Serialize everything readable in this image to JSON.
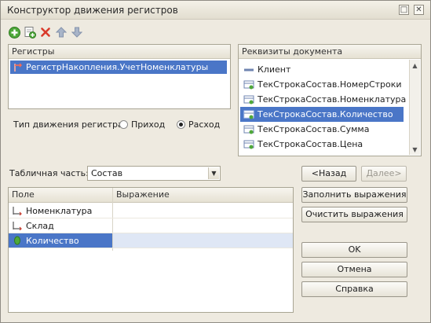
{
  "window": {
    "title": "Конструктор движения регистров",
    "buttons": {
      "restore_glyph": "□",
      "close_glyph": "✕"
    }
  },
  "toolbar": {
    "icons": [
      "add-icon",
      "copy-icon",
      "delete-icon",
      "move-up-icon",
      "move-down-icon"
    ]
  },
  "registers": {
    "header": "Регистры",
    "items": [
      {
        "label": "РегистрНакопления.УчетНоменклатуры"
      }
    ]
  },
  "attributes": {
    "header": "Реквизиты документа",
    "items": [
      {
        "label": "Клиент"
      },
      {
        "label": "ТекСтрокаСостав.НомерСтроки"
      },
      {
        "label": "ТекСтрокаСостав.Номенклатура"
      },
      {
        "label": "ТекСтрокаСостав.Количество",
        "selected": true
      },
      {
        "label": "ТекСтрокаСостав.Сумма"
      },
      {
        "label": "ТекСтрокаСостав.Цена"
      }
    ]
  },
  "movement_type": {
    "label": "Тип движения регистра:",
    "options": [
      {
        "label": "Приход",
        "checked": false
      },
      {
        "label": "Расход",
        "checked": true
      }
    ]
  },
  "tabular_part": {
    "label": "Табличная часть:",
    "value": "Состав"
  },
  "grid": {
    "columns": [
      "Поле",
      "Выражение"
    ],
    "rows": [
      {
        "field": "Номенклатура",
        "expression": ""
      },
      {
        "field": "Склад",
        "expression": ""
      },
      {
        "field": "Количество",
        "expression": "",
        "selected": true
      }
    ]
  },
  "buttons": {
    "back": "<Назад",
    "next": "Далее>",
    "fill": "Заполнить выражения",
    "clear": "Очистить выражения",
    "ok": "OK",
    "cancel": "Отмена",
    "help": "Справка"
  },
  "colors": {
    "selection": "#4a76c7",
    "add_green": "#4fa83a",
    "delete_red": "#d93a2b"
  }
}
